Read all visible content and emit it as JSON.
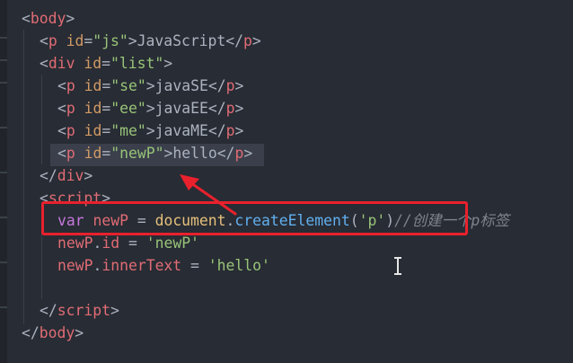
{
  "editor": {
    "lines": [
      {
        "tokens": [
          {
            "t": "<",
            "c": "punc"
          },
          {
            "t": "body",
            "c": "tag"
          },
          {
            "t": ">",
            "c": "punc"
          }
        ]
      },
      {
        "tokens": [
          {
            "t": "<",
            "c": "punc"
          },
          {
            "t": "p",
            "c": "tag"
          },
          {
            "t": " ",
            "c": "txt"
          },
          {
            "t": "id",
            "c": "attr"
          },
          {
            "t": "=",
            "c": "punc"
          },
          {
            "t": "\"js\"",
            "c": "str"
          },
          {
            "t": ">",
            "c": "punc"
          },
          {
            "t": "JavaScript",
            "c": "txt"
          },
          {
            "t": "</",
            "c": "punc"
          },
          {
            "t": "p",
            "c": "tag"
          },
          {
            "t": ">",
            "c": "punc"
          }
        ]
      },
      {
        "tokens": [
          {
            "t": "<",
            "c": "punc"
          },
          {
            "t": "div",
            "c": "tag"
          },
          {
            "t": " ",
            "c": "txt"
          },
          {
            "t": "id",
            "c": "attr"
          },
          {
            "t": "=",
            "c": "punc"
          },
          {
            "t": "\"list\"",
            "c": "str"
          },
          {
            "t": ">",
            "c": "punc"
          }
        ]
      },
      {
        "tokens": [
          {
            "t": "<",
            "c": "punc"
          },
          {
            "t": "p",
            "c": "tag"
          },
          {
            "t": " ",
            "c": "txt"
          },
          {
            "t": "id",
            "c": "attr"
          },
          {
            "t": "=",
            "c": "punc"
          },
          {
            "t": "\"se\"",
            "c": "str"
          },
          {
            "t": ">",
            "c": "punc"
          },
          {
            "t": "javaSE",
            "c": "txt"
          },
          {
            "t": "</",
            "c": "punc"
          },
          {
            "t": "p",
            "c": "tag"
          },
          {
            "t": ">",
            "c": "punc"
          }
        ]
      },
      {
        "tokens": [
          {
            "t": "<",
            "c": "punc"
          },
          {
            "t": "p",
            "c": "tag"
          },
          {
            "t": " ",
            "c": "txt"
          },
          {
            "t": "id",
            "c": "attr"
          },
          {
            "t": "=",
            "c": "punc"
          },
          {
            "t": "\"ee\"",
            "c": "str"
          },
          {
            "t": ">",
            "c": "punc"
          },
          {
            "t": "javaEE",
            "c": "txt"
          },
          {
            "t": "</",
            "c": "punc"
          },
          {
            "t": "p",
            "c": "tag"
          },
          {
            "t": ">",
            "c": "punc"
          }
        ]
      },
      {
        "tokens": [
          {
            "t": "<",
            "c": "punc"
          },
          {
            "t": "p",
            "c": "tag"
          },
          {
            "t": " ",
            "c": "txt"
          },
          {
            "t": "id",
            "c": "attr"
          },
          {
            "t": "=",
            "c": "punc"
          },
          {
            "t": "\"me\"",
            "c": "str"
          },
          {
            "t": ">",
            "c": "punc"
          },
          {
            "t": "javaME",
            "c": "txt"
          },
          {
            "t": "</",
            "c": "punc"
          },
          {
            "t": "p",
            "c": "tag"
          },
          {
            "t": ">",
            "c": "punc"
          }
        ]
      },
      {
        "tokens": [
          {
            "t": "<",
            "c": "punc"
          },
          {
            "t": "p",
            "c": "tag"
          },
          {
            "t": " ",
            "c": "txt"
          },
          {
            "t": "id",
            "c": "attr"
          },
          {
            "t": "=",
            "c": "punc"
          },
          {
            "t": "\"newP\"",
            "c": "str"
          },
          {
            "t": ">",
            "c": "punc"
          },
          {
            "t": "hello",
            "c": "txt"
          },
          {
            "t": "</",
            "c": "punc"
          },
          {
            "t": "p",
            "c": "tag"
          },
          {
            "t": ">",
            "c": "punc"
          }
        ]
      },
      {
        "tokens": [
          {
            "t": "</",
            "c": "punc"
          },
          {
            "t": "div",
            "c": "tag"
          },
          {
            "t": ">",
            "c": "punc"
          }
        ]
      },
      {
        "tokens": [
          {
            "t": "<",
            "c": "punc"
          },
          {
            "t": "script",
            "c": "tag"
          },
          {
            "t": ">",
            "c": "punc"
          }
        ]
      },
      {
        "tokens": [
          {
            "t": "var",
            "c": "kw"
          },
          {
            "t": " ",
            "c": "txt"
          },
          {
            "t": "newP",
            "c": "var"
          },
          {
            "t": " = ",
            "c": "txt"
          },
          {
            "t": "document",
            "c": "obj"
          },
          {
            "t": ".",
            "c": "txt"
          },
          {
            "t": "createElement",
            "c": "fn"
          },
          {
            "t": "(",
            "c": "txt"
          },
          {
            "t": "'p'",
            "c": "str"
          },
          {
            "t": ")",
            "c": "txt"
          },
          {
            "t": "//创建一个p标签",
            "c": "cmt"
          }
        ]
      },
      {
        "tokens": [
          {
            "t": "newP",
            "c": "var"
          },
          {
            "t": ".",
            "c": "txt"
          },
          {
            "t": "id",
            "c": "var"
          },
          {
            "t": " = ",
            "c": "txt"
          },
          {
            "t": "'newP'",
            "c": "str"
          }
        ]
      },
      {
        "tokens": [
          {
            "t": "newP",
            "c": "var"
          },
          {
            "t": ".",
            "c": "txt"
          },
          {
            "t": "innerText",
            "c": "var"
          },
          {
            "t": " = ",
            "c": "txt"
          },
          {
            "t": "'hello'",
            "c": "str"
          }
        ]
      },
      {
        "tokens": []
      },
      {
        "tokens": [
          {
            "t": "</",
            "c": "punc"
          },
          {
            "t": "script",
            "c": "tag"
          },
          {
            "t": ">",
            "c": "punc"
          }
        ]
      },
      {
        "tokens": [
          {
            "t": "</",
            "c": "punc"
          },
          {
            "t": "body",
            "c": "tag"
          },
          {
            "t": ">",
            "c": "punc"
          }
        ]
      }
    ]
  },
  "annotation": {
    "box_color": "#e8212d",
    "arrow_color": "#e8212d"
  }
}
